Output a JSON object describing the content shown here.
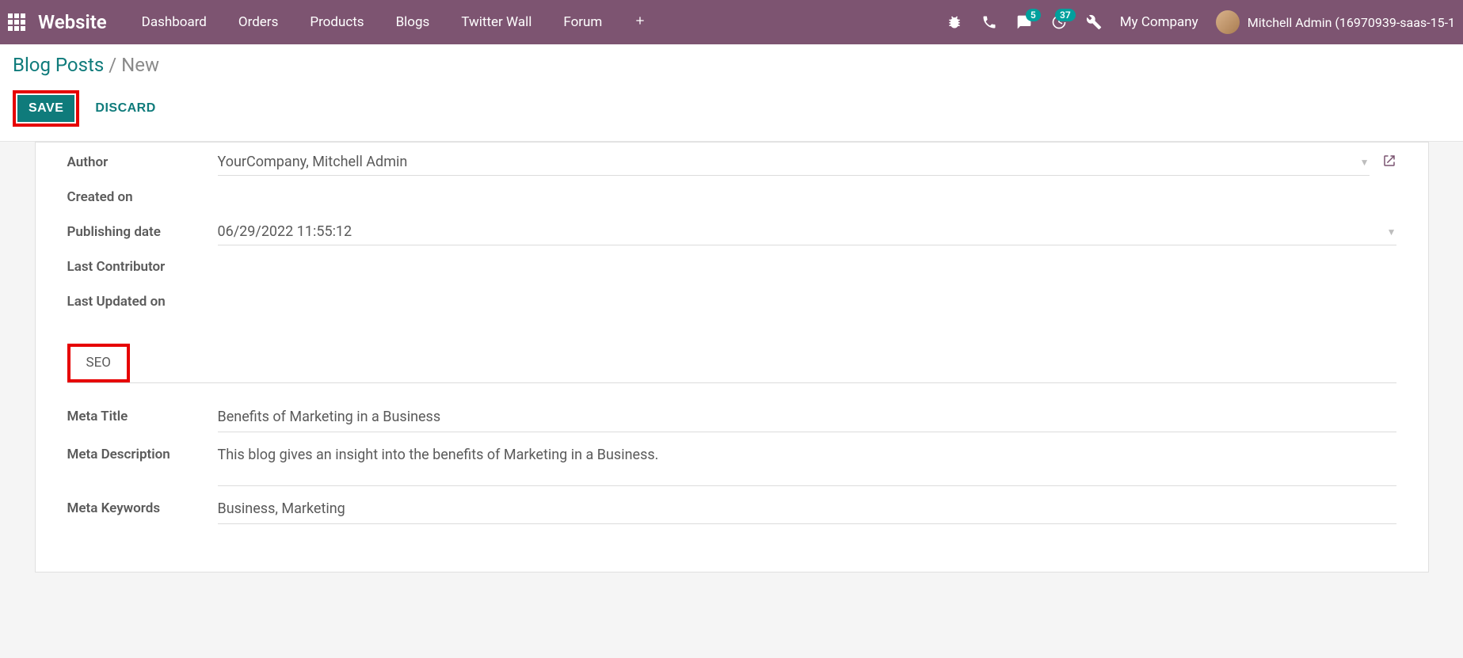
{
  "navbar": {
    "brand": "Website",
    "menu": [
      "Dashboard",
      "Orders",
      "Products",
      "Blogs",
      "Twitter Wall",
      "Forum"
    ],
    "chat_badge": "5",
    "activity_badge": "37",
    "company": "My Company",
    "username": "Mitchell Admin (16970939-saas-15-1"
  },
  "breadcrumb": {
    "root": "Blog Posts",
    "sep": "/",
    "current": "New"
  },
  "actions": {
    "save": "Save",
    "discard": "Discard"
  },
  "form": {
    "labels": {
      "author": "Author",
      "created_on": "Created on",
      "publishing_date": "Publishing date",
      "last_contributor": "Last Contributor",
      "last_updated_on": "Last Updated on"
    },
    "author": "YourCompany, Mitchell Admin",
    "created_on": "",
    "publishing_date": "06/29/2022 11:55:12",
    "last_contributor": "",
    "last_updated_on": ""
  },
  "tabs": {
    "seo": "SEO"
  },
  "seo": {
    "labels": {
      "meta_title": "Meta Title",
      "meta_description": "Meta Description",
      "meta_keywords": "Meta Keywords"
    },
    "meta_title": "Benefits of Marketing in a Business",
    "meta_description": "This blog gives an insight into the benefits of Marketing in a Business.",
    "meta_keywords": "Business, Marketing"
  }
}
